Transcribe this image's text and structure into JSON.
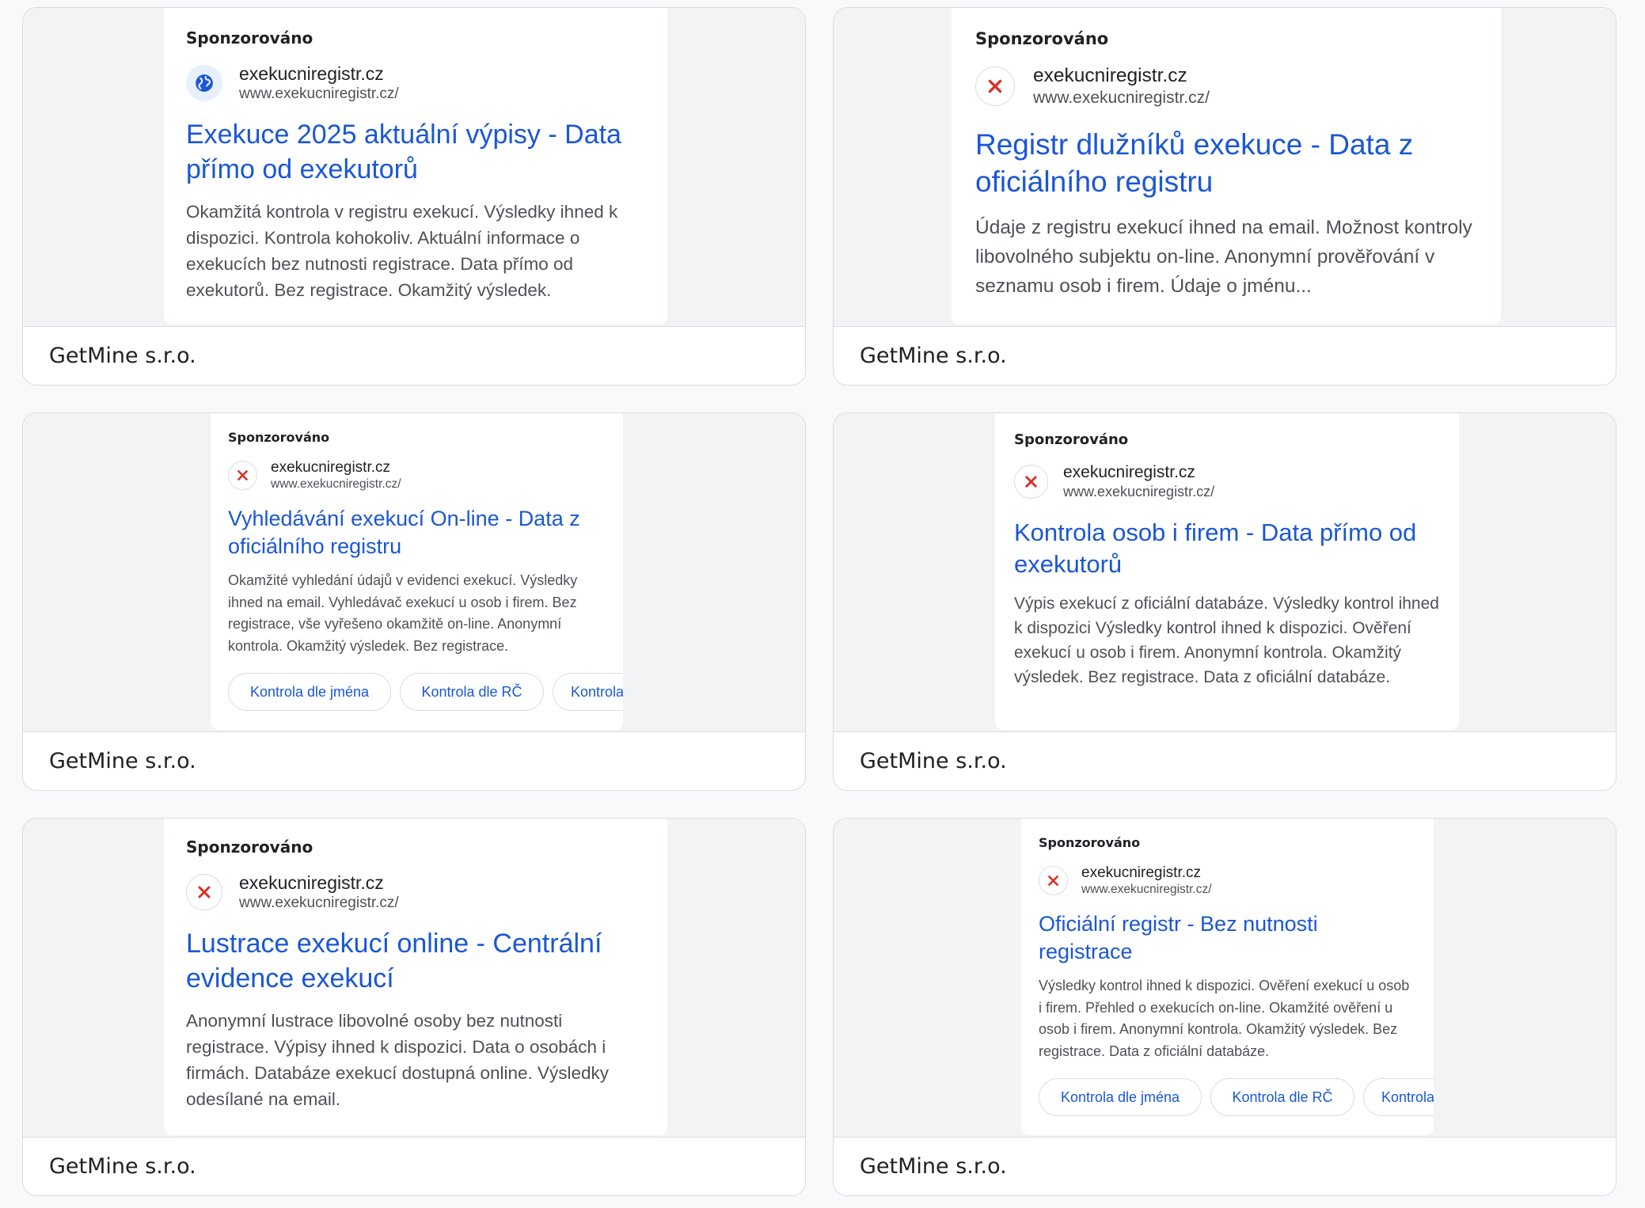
{
  "ads": [
    {
      "sponsored_label": "Sponzorováno",
      "favicon": "globe-icon",
      "site_name": "exekucniregistr.cz",
      "site_url": "www.exekucniregistr.cz/",
      "headline": "Exekuce 2025 aktuální výpisy - Data přímo od exekutorů",
      "description": "Okamžitá kontrola v registru exekucí. Výsledky ihned k dispozici. Kontrola kohokoliv. Aktuální informace o exekucích bez nutnosti registrace. Data přímo od exekutorů. Bez registrace. Okamžitý výsledek.",
      "advertiser": "GetMine s.r.o."
    },
    {
      "sponsored_label": "Sponzorováno",
      "favicon": "broken-image-icon",
      "site_name": "exekucniregistr.cz",
      "site_url": "www.exekucniregistr.cz/",
      "headline": "Registr dlužníků exekuce - Data z oficiálního registru",
      "description": "Údaje z registru exekucí ihned na email. Možnost kontroly libovolného subjektu on-line. Anonymní prověřování v seznamu osob i firem. Údaje o jménu...",
      "advertiser": "GetMine s.r.o."
    },
    {
      "sponsored_label": "Sponzorováno",
      "favicon": "broken-image-icon",
      "site_name": "exekucniregistr.cz",
      "site_url": "www.exekucniregistr.cz/",
      "headline": "Vyhledávání exekucí On-line - Data z oficiálního registru",
      "description": "Okamžité vyhledání údajů v evidenci exekucí. Výsledky ihned na email. Vyhledávač exekucí u osob i firem. Bez registrace, vše vyřešeno okamžitě on-line. Anonymní kontrola. Okamžitý výsledek. Bez registrace.",
      "sitelinks": [
        "Kontrola dle jména",
        "Kontrola dle RČ",
        "Kontrola"
      ],
      "advertiser": "GetMine s.r.o."
    },
    {
      "sponsored_label": "Sponzorováno",
      "favicon": "broken-image-icon",
      "site_name": "exekucniregistr.cz",
      "site_url": "www.exekucniregistr.cz/",
      "headline": "Kontrola osob i firem - Data přímo od exekutorů",
      "description": "Výpis exekucí z oficiální databáze. Výsledky kontrol ihned k dispozici Výsledky kontrol ihned k dispozici. Ověření exekucí u osob i firem. Anonymní kontrola. Okamžitý výsledek. Bez registrace. Data z oficiální databáze.",
      "advertiser": "GetMine s.r.o."
    },
    {
      "sponsored_label": "Sponzorováno",
      "favicon": "broken-image-icon",
      "site_name": "exekucniregistr.cz",
      "site_url": "www.exekucniregistr.cz/",
      "headline": "Lustrace exekucí online - Centrální evidence exekucí",
      "description": "Anonymní lustrace libovolné osoby bez nutnosti registrace. Výpisy ihned k dispozici. Data o osobách i firmách. Databáze exekucí dostupná online. Výsledky odesílané na email.",
      "advertiser": "GetMine s.r.o."
    },
    {
      "sponsored_label": "Sponzorováno",
      "favicon": "broken-image-icon",
      "site_name": "exekucniregistr.cz",
      "site_url": "www.exekucniregistr.cz/",
      "headline": "Oficiální registr - Bez nutnosti registrace",
      "description": "Výsledky kontrol ihned k dispozici. Ověření exekucí u osob i firem. Přehled o exekucích on-line. Okamžité ověření u osob i firem. Anonymní kontrola. Okamžitý výsledek. Bez registrace. Data z oficiální databáze.",
      "sitelinks": [
        "Kontrola dle jména",
        "Kontrola dle RČ",
        "Kontrola"
      ],
      "advertiser": "GetMine s.r.o."
    }
  ],
  "colors": {
    "headline": "#1a57d6",
    "body_text": "#4d5156",
    "card_border": "#dadce0",
    "preview_bg": "#f1f3f4",
    "broken_icon": "#d93025",
    "globe_icon": "#1a57d6"
  }
}
